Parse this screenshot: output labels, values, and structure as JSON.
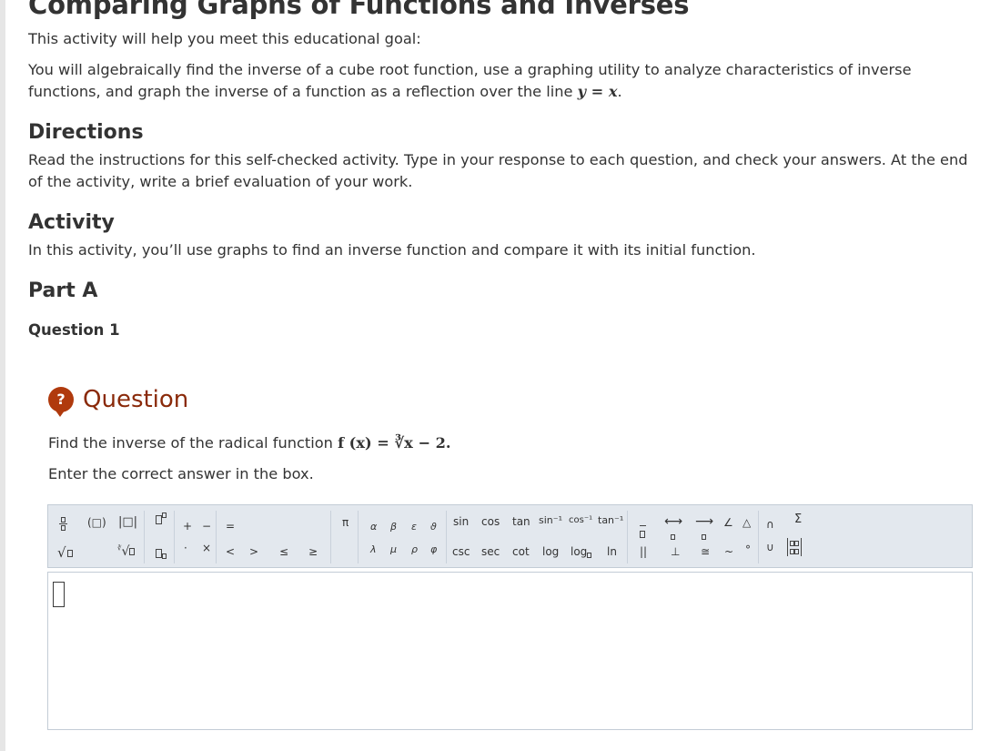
{
  "page": {
    "title": "Comparing Graphs of Functions and Inverses",
    "goal_intro": "This activity will help you meet this educational goal:",
    "goal_text": "You will algebraically find the inverse of a cube root function, use a graphing utility to analyze characteristics of inverse functions, and graph the inverse of a function as a reflection over the line",
    "goal_math_y": "y",
    "goal_math_eq": " = ",
    "goal_math_x": "x",
    "goal_period": ".",
    "directions_heading": "Directions",
    "directions_text": "Read the instructions for this self-checked activity. Type in your response to each question, and check your answers. At the end of the activity, write a brief evaluation of your work.",
    "activity_heading": "Activity",
    "activity_text": "In this activity, you’ll use graphs to find an inverse function and compare it with its initial function.",
    "part_heading": "Part A",
    "question_number": "Question 1"
  },
  "question": {
    "icon_glyph": "?",
    "title": "Question",
    "prompt": "Find the inverse of the radical function",
    "function_expr": "f (x) = ∛x − 2.",
    "instruction": "Enter the correct answer in the box."
  },
  "toolbar": {
    "paren": "(□)",
    "abs": "|□|",
    "plus": "+",
    "minus": "−",
    "equals": "=",
    "dot": "·",
    "times": "×",
    "lt": "<",
    "gt": ">",
    "le": "≤",
    "ge": "≥",
    "pi": "π",
    "alpha": "α",
    "beta": "β",
    "epsilon": "ε",
    "theta": "ϑ",
    "lambda": "λ",
    "mu": "μ",
    "rho": "ρ",
    "phi": "φ",
    "sin": "sin",
    "cos": "cos",
    "tan": "tan",
    "arcsin": "sin⁻¹",
    "arccos": "cos⁻¹",
    "arctan": "tan⁻¹",
    "csc": "csc",
    "sec": "sec",
    "cot": "cot",
    "log": "log",
    "logb": "log",
    "ln": "ln",
    "parallel": "||",
    "perp": "⊥",
    "congruent": "≅",
    "similar": "~",
    "degree": "°",
    "angle": "∠",
    "triangle": "△",
    "intersect": "∩",
    "union": "∪",
    "sum": "Σ"
  },
  "answer": {
    "value": ""
  }
}
